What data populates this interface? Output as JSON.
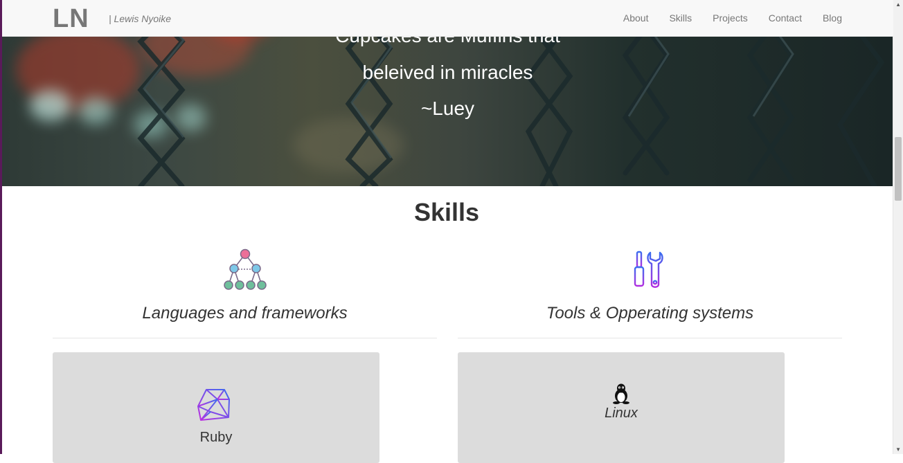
{
  "navbar": {
    "brand": "LN",
    "tagline": "| Lewis Nyoike",
    "links": [
      "About",
      "Skills",
      "Projects",
      "Contact",
      "Blog"
    ]
  },
  "hero": {
    "quote_lines": [
      "Cupcakes are Muffins that",
      "beleived in miracles",
      "~Luey"
    ]
  },
  "skills": {
    "title": "Skills",
    "columns": [
      {
        "title": "Languages and frameworks",
        "icon": "network-tree-icon"
      },
      {
        "title": "Tools & Opperating systems",
        "icon": "tools-icon"
      }
    ],
    "cards": [
      {
        "label": "Ruby",
        "icon": "ruby-gem-icon"
      },
      {
        "label": "Linux",
        "icon": "linux-tux-icon"
      }
    ]
  }
}
